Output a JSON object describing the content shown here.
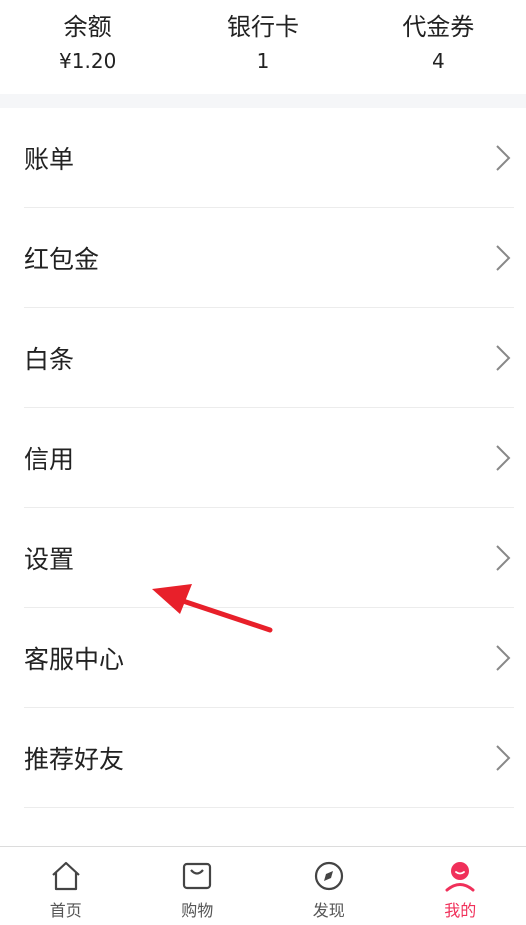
{
  "stats": [
    {
      "label": "余额",
      "value": "¥1.20"
    },
    {
      "label": "银行卡",
      "value": "1"
    },
    {
      "label": "代金券",
      "value": "4"
    }
  ],
  "menu": {
    "items": [
      {
        "label": "账单"
      },
      {
        "label": "红包金"
      },
      {
        "label": "白条"
      },
      {
        "label": "信用"
      },
      {
        "label": "设置"
      },
      {
        "label": "客服中心"
      },
      {
        "label": "推荐好友"
      }
    ]
  },
  "tabbar": {
    "items": [
      {
        "label": "首页",
        "icon": "home-icon"
      },
      {
        "label": "购物",
        "icon": "shopping-bag-icon"
      },
      {
        "label": "发现",
        "icon": "compass-icon"
      },
      {
        "label": "我的",
        "icon": "profile-icon",
        "active": true
      }
    ]
  },
  "colors": {
    "accent": "#f0305a",
    "annotation_arrow": "#e8202a",
    "divider": "#ececec",
    "section_gap": "#f5f6f8"
  }
}
